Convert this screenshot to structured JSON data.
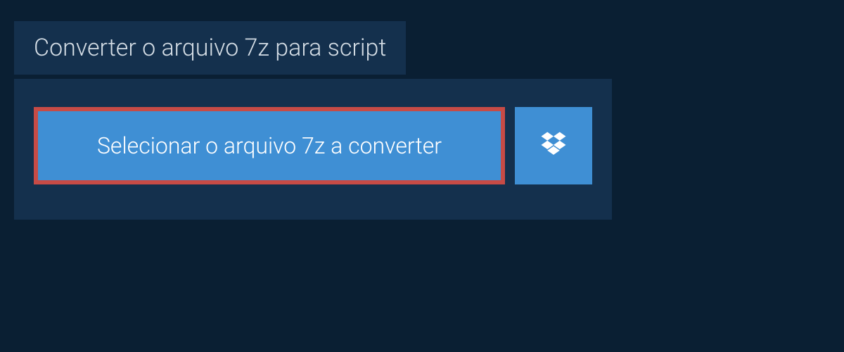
{
  "header": {
    "title": "Converter o arquivo 7z para script"
  },
  "actions": {
    "select_file_label": "Selecionar o arquivo 7z a converter"
  }
}
